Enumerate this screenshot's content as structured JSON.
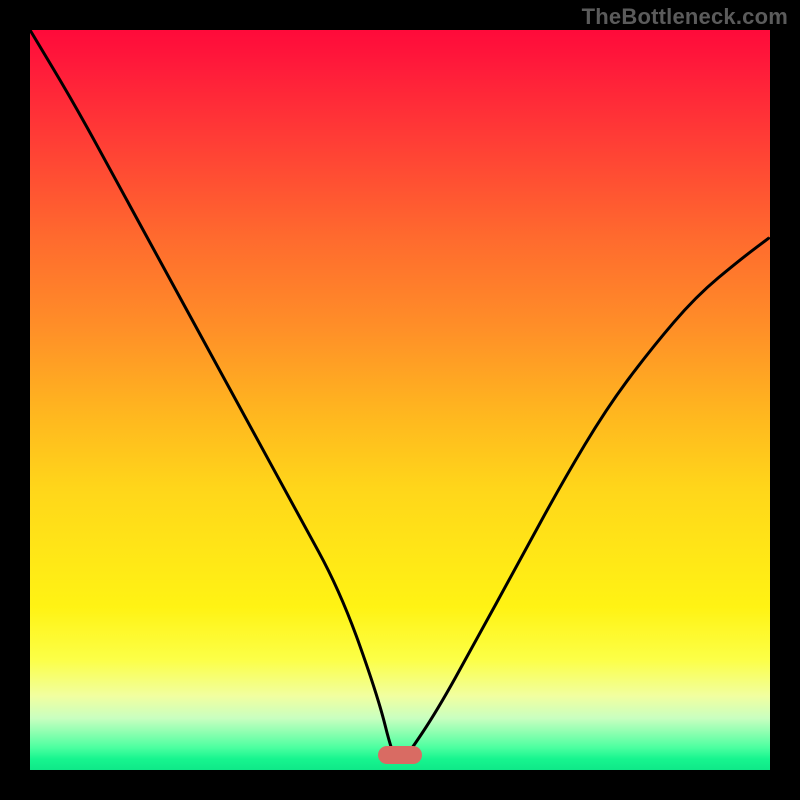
{
  "watermark": "TheBottleneck.com",
  "marker_color": "#d96b63",
  "chart_data": {
    "type": "line",
    "title": "",
    "xlabel": "",
    "ylabel": "",
    "xlim": [
      0,
      100
    ],
    "ylim": [
      0,
      100
    ],
    "series": [
      {
        "name": "bottleneck-curve",
        "x": [
          0,
          6,
          12,
          18,
          24,
          30,
          36,
          42,
          47,
          49,
          50,
          51,
          55,
          60,
          66,
          72,
          78,
          84,
          90,
          96,
          100
        ],
        "y": [
          100,
          90,
          79,
          68,
          57,
          46,
          35,
          24,
          10,
          2,
          1,
          2,
          8,
          17,
          28,
          39,
          49,
          57,
          64,
          69,
          72
        ]
      }
    ],
    "marker": {
      "x": 50,
      "y": 1,
      "color": "#d96b63"
    },
    "background_gradient": {
      "0": "#ff0a3a",
      "50": "#ffd61a",
      "85": "#fcff46",
      "100": "#0fe888"
    }
  }
}
